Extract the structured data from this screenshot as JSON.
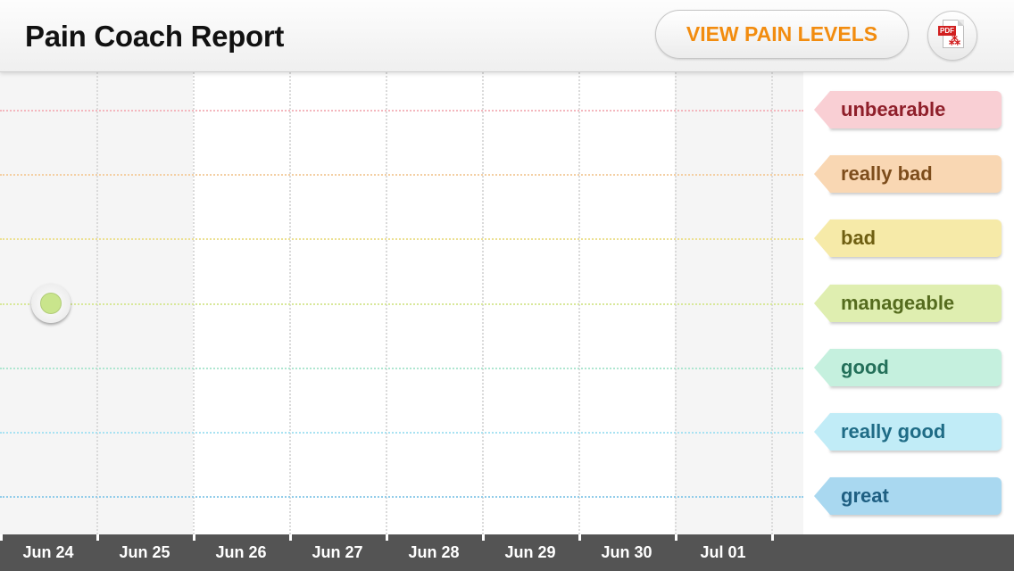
{
  "header": {
    "title": "Pain Coach Report",
    "view_button_label": "VIEW PAIN LEVELS",
    "pdf_icon_label": "PDF",
    "accent_color": "#f28c0f"
  },
  "pain_levels": [
    {
      "label": "unbearable",
      "bg": "#f9cfd4",
      "text": "#8f1f2a",
      "line": "#f4b6bd"
    },
    {
      "label": "really bad",
      "bg": "#f9d7b3",
      "text": "#7d4d1c",
      "line": "#f4cfa3"
    },
    {
      "label": "bad",
      "bg": "#f6eaa8",
      "text": "#6f5f12",
      "line": "#ece092"
    },
    {
      "label": "manageable",
      "bg": "#dfeeb0",
      "text": "#556b1e",
      "line": "#d8e89a"
    },
    {
      "label": "good",
      "bg": "#c5f0de",
      "text": "#24705a",
      "line": "#aee6d0"
    },
    {
      "label": "really good",
      "bg": "#c1ecf7",
      "text": "#1f6c86",
      "line": "#a8e2f2"
    },
    {
      "label": "great",
      "bg": "#a9d8f0",
      "text": "#1f5f82",
      "line": "#93cdea"
    }
  ],
  "chart_data": {
    "type": "scatter",
    "categories": [
      "Jun 24",
      "Jun 25",
      "Jun 26",
      "Jun 27",
      "Jun 28",
      "Jun 29",
      "Jun 30",
      "Jul 01"
    ],
    "levels": [
      "unbearable",
      "really bad",
      "bad",
      "manageable",
      "good",
      "really good",
      "great"
    ],
    "points": [
      {
        "date": "Jun 24",
        "level": "manageable"
      }
    ],
    "point_color": "#c9e58c",
    "grid": true
  }
}
